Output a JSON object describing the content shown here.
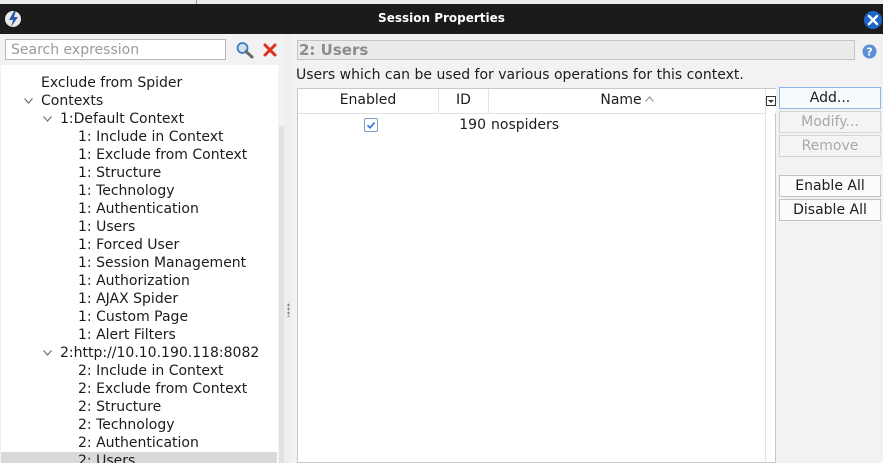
{
  "window": {
    "title": "Session Properties"
  },
  "search": {
    "placeholder": "Search expression",
    "value": ""
  },
  "tree": [
    {
      "label": "Exclude from Spider",
      "level": 1,
      "toggle": "none",
      "selected": false
    },
    {
      "label": "Contexts",
      "level": 1,
      "toggle": "expanded",
      "selected": false
    },
    {
      "label": "1:Default Context",
      "level": 2,
      "toggle": "expanded",
      "selected": false
    },
    {
      "label": "1: Include in Context",
      "level": 3,
      "toggle": "none",
      "selected": false
    },
    {
      "label": "1: Exclude from Context",
      "level": 3,
      "toggle": "none",
      "selected": false
    },
    {
      "label": "1: Structure",
      "level": 3,
      "toggle": "none",
      "selected": false
    },
    {
      "label": "1: Technology",
      "level": 3,
      "toggle": "none",
      "selected": false
    },
    {
      "label": "1: Authentication",
      "level": 3,
      "toggle": "none",
      "selected": false
    },
    {
      "label": "1: Users",
      "level": 3,
      "toggle": "none",
      "selected": false
    },
    {
      "label": "1: Forced User",
      "level": 3,
      "toggle": "none",
      "selected": false
    },
    {
      "label": "1: Session Management",
      "level": 3,
      "toggle": "none",
      "selected": false
    },
    {
      "label": "1: Authorization",
      "level": 3,
      "toggle": "none",
      "selected": false
    },
    {
      "label": "1: AJAX Spider",
      "level": 3,
      "toggle": "none",
      "selected": false
    },
    {
      "label": "1: Custom Page",
      "level": 3,
      "toggle": "none",
      "selected": false
    },
    {
      "label": "1: Alert Filters",
      "level": 3,
      "toggle": "none",
      "selected": false
    },
    {
      "label": "2:http://10.10.190.118:8082",
      "level": 2,
      "toggle": "expanded",
      "selected": false
    },
    {
      "label": "2: Include in Context",
      "level": 3,
      "toggle": "none",
      "selected": false
    },
    {
      "label": "2: Exclude from Context",
      "level": 3,
      "toggle": "none",
      "selected": false
    },
    {
      "label": "2: Structure",
      "level": 3,
      "toggle": "none",
      "selected": false
    },
    {
      "label": "2: Technology",
      "level": 3,
      "toggle": "none",
      "selected": false
    },
    {
      "label": "2: Authentication",
      "level": 3,
      "toggle": "none",
      "selected": false
    },
    {
      "label": "2: Users",
      "level": 3,
      "toggle": "none",
      "selected": true
    }
  ],
  "panel": {
    "title": "2: Users",
    "description": "Users which can be used for various operations for this context."
  },
  "table": {
    "columns": {
      "enabled": "Enabled",
      "id": "ID",
      "name": "Name"
    },
    "sort": "Name ascending",
    "rows": [
      {
        "enabled": true,
        "id": "190",
        "name": "nospiders"
      }
    ]
  },
  "buttons": {
    "add": "Add...",
    "modify": "Modify...",
    "remove": "Remove",
    "enable_all": "Enable All",
    "disable_all": "Disable All"
  },
  "icons": {
    "app": "zap-icon",
    "close": "close-window-icon",
    "search": "search-icon",
    "clear": "clear-search-icon",
    "help": "help-icon",
    "sort": "sort-ascending-icon",
    "column_picker": "column-control-icon"
  },
  "colors": {
    "titlebar": "#1b1b1b",
    "close_button": "#1e63c8",
    "clear_icon": "#e0301e",
    "checkbox_check": "#3574d4",
    "selected_row": "#d9d9d9"
  }
}
